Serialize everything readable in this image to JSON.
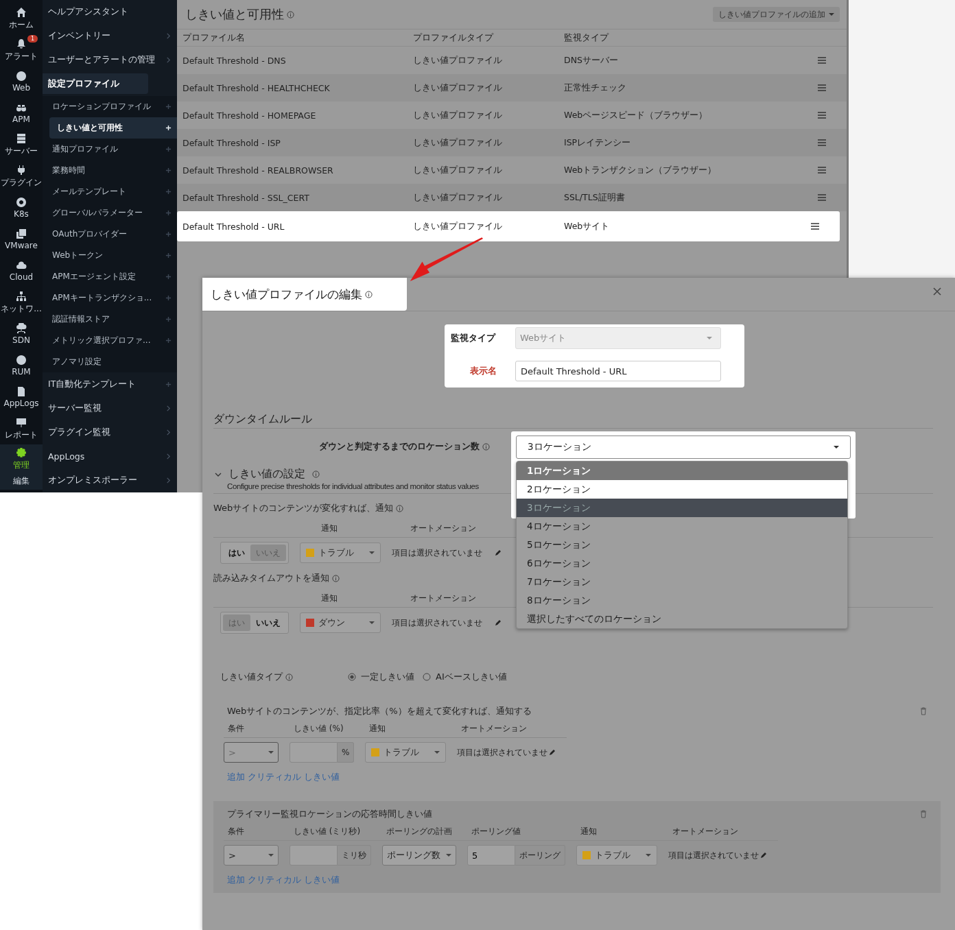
{
  "sidebar": {
    "rail": [
      {
        "label": "ホーム",
        "selected": false
      },
      {
        "label": "アラート",
        "badge": "1",
        "selected": false
      },
      {
        "label": "Web",
        "selected": false
      },
      {
        "label": "APM",
        "selected": false
      },
      {
        "label": "サーバー",
        "selected": false
      },
      {
        "label": "プラグイン",
        "selected": false
      },
      {
        "label": "K8s",
        "selected": false
      },
      {
        "label": "VMware",
        "selected": false
      },
      {
        "label": "Cloud",
        "selected": false
      },
      {
        "label": "ネットワ...",
        "selected": false
      },
      {
        "label": "SDN",
        "selected": false
      },
      {
        "label": "RUM",
        "selected": false
      },
      {
        "label": "AppLogs",
        "selected": false
      },
      {
        "label": "レポート",
        "selected": false
      },
      {
        "label": "管理",
        "sublabel": "編集",
        "selected": true
      }
    ],
    "menu": [
      {
        "label": "ヘルプアシスタント",
        "kind": "page"
      },
      {
        "label": "インベントリー",
        "kind": "group"
      },
      {
        "label": "ユーザーとアラートの管理",
        "kind": "group"
      },
      {
        "label": "設定プロファイル",
        "kind": "group",
        "expanded": true,
        "children": [
          {
            "label": "ロケーションプロファイル",
            "kind": "addable",
            "selected": false
          },
          {
            "label": "しきい値と可用性",
            "kind": "addable",
            "selected": true
          },
          {
            "label": "通知プロファイル",
            "kind": "addable",
            "selected": false
          },
          {
            "label": "業務時間",
            "kind": "addable",
            "selected": false
          },
          {
            "label": "メールテンプレート",
            "kind": "addable",
            "selected": false
          },
          {
            "label": "グローバルパラメーター",
            "kind": "addable",
            "selected": false
          },
          {
            "label": "OAuthプロバイダー",
            "kind": "addable",
            "selected": false
          },
          {
            "label": "Webトークン",
            "kind": "addable",
            "selected": false
          },
          {
            "label": "APMエージェント設定",
            "kind": "addable",
            "selected": false
          },
          {
            "label": "APMキートランザクショ...",
            "kind": "addable",
            "selected": false
          },
          {
            "label": "認証情報ストア",
            "kind": "addable",
            "selected": false
          },
          {
            "label": "メトリック選択プロファ...",
            "kind": "addable",
            "selected": false
          },
          {
            "label": "アノマリ設定",
            "kind": "page",
            "selected": false
          }
        ]
      },
      {
        "label": "IT自動化テンプレート",
        "kind": "addable"
      },
      {
        "label": "サーバー監視",
        "kind": "group"
      },
      {
        "label": "プラグイン監視",
        "kind": "group"
      },
      {
        "label": "AppLogs",
        "kind": "group"
      },
      {
        "label": "オンプレミスポーラー",
        "kind": "group"
      }
    ]
  },
  "list": {
    "title": "しきい値と可用性",
    "add_button": "しきい値プロファイルの追加",
    "columns": [
      "プロファイル名",
      "プロファイルタイプ",
      "監視タイプ"
    ],
    "rows": [
      {
        "name": "Default Threshold - DNS",
        "type": "しきい値プロファイル",
        "monitor": "DNSサーバー",
        "selected": false
      },
      {
        "name": "Default Threshold - HEALTHCHECK",
        "type": "しきい値プロファイル",
        "monitor": "正常性チェック",
        "selected": false
      },
      {
        "name": "Default Threshold - HOMEPAGE",
        "type": "しきい値プロファイル",
        "monitor": "Webページスピード（ブラウザー）",
        "selected": false
      },
      {
        "name": "Default Threshold - ISP",
        "type": "しきい値プロファイル",
        "monitor": "ISPレイテンシー",
        "selected": false
      },
      {
        "name": "Default Threshold - REALBROWSER",
        "type": "しきい値プロファイル",
        "monitor": "Webトランザクション（ブラウザー）",
        "selected": false
      },
      {
        "name": "Default Threshold - SSL_CERT",
        "type": "しきい値プロファイル",
        "monitor": "SSL/TLS証明書",
        "selected": false
      },
      {
        "name": "Default Threshold - URL",
        "type": "しきい値プロファイル",
        "monitor": "Webサイト",
        "selected": true
      }
    ]
  },
  "dialog": {
    "title": "しきい値プロファイルの編集",
    "monitor_type": {
      "label": "監視タイプ",
      "value": "Webサイト",
      "disabled": true
    },
    "display_name": {
      "label": "表示名",
      "value": "Default Threshold - URL",
      "required": true
    },
    "downtime": {
      "heading": "ダウンタイムルール",
      "label": "ダウンと判定するまでのロケーション数",
      "value": "3ロケーション",
      "open": true,
      "options": [
        {
          "label": "1ロケーション",
          "highlighted": true,
          "selected": false
        },
        {
          "label": "2ロケーション",
          "highlighted": false,
          "selected": false
        },
        {
          "label": "3ロケーション",
          "highlighted": false,
          "selected": true
        },
        {
          "label": "4ロケーション",
          "highlighted": false,
          "selected": false
        },
        {
          "label": "5ロケーション",
          "highlighted": false,
          "selected": false
        },
        {
          "label": "6ロケーション",
          "highlighted": false,
          "selected": false
        },
        {
          "label": "7ロケーション",
          "highlighted": false,
          "selected": false
        },
        {
          "label": "8ロケーション",
          "highlighted": false,
          "selected": false
        },
        {
          "label": "選択したすべてのロケーション",
          "highlighted": false,
          "selected": false
        }
      ]
    },
    "thresholds": {
      "heading": "しきい値の設定",
      "expanded": true,
      "description": "Configure precise thresholds for individual attributes and monitor status values",
      "rules": [
        {
          "title": "Webサイトのコンテンツが変化すれば、通知",
          "headers": [
            "通知",
            "オートメーション"
          ],
          "toggle": [
            {
              "label": "はい",
              "selected": true
            },
            {
              "label": "いいえ",
              "selected": false
            }
          ],
          "severity": {
            "label": "トラブル",
            "color": "#d4a017"
          },
          "automation": "項目は選択されていませ"
        },
        {
          "title": "読み込みタイムアウトを通知",
          "headers": [
            "通知",
            "オートメーション"
          ],
          "toggle": [
            {
              "label": "はい",
              "selected": false
            },
            {
              "label": "いいえ",
              "selected": true
            }
          ],
          "severity": {
            "label": "ダウン",
            "color": "#c0392b"
          },
          "automation": "項目は選択されていませ"
        }
      ],
      "type_label": "しきい値タイプ",
      "types": [
        {
          "label": "一定しきい値",
          "selected": true
        },
        {
          "label": "AIベースしきい値",
          "selected": false
        }
      ],
      "blocks": [
        {
          "title": "Webサイトのコンテンツが、指定比率（%）を超えて変化すれば、通知する",
          "shaded": false,
          "columns": [
            {
              "header": "条件",
              "kind": "select",
              "value": ">",
              "dim": true
            },
            {
              "header": "しきい値 (%)",
              "kind": "addon",
              "addon": "%"
            },
            {
              "header": "通知",
              "kind": "severity",
              "value": "トラブル",
              "color": "#d4a017"
            },
            {
              "header": "オートメーション",
              "kind": "text",
              "value": "項目は選択されていませ"
            }
          ],
          "link": "追加 クリティカル しきい値"
        },
        {
          "title": "プライマリー監視ロケーションの応答時間しきい値",
          "shaded": true,
          "columns": [
            {
              "header": "条件",
              "kind": "select",
              "value": ">",
              "dim": false
            },
            {
              "header": "しきい値 (ミリ秒)",
              "kind": "addon",
              "addon": "ミリ秒"
            },
            {
              "header": "ポーリングの計画",
              "kind": "select",
              "value": "ポーリング数",
              "dim": false
            },
            {
              "header": "ポーリング値",
              "kind": "addon",
              "value": "5",
              "addon": "ポーリング"
            },
            {
              "header": "通知",
              "kind": "severity",
              "value": "トラブル",
              "color": "#d4a017"
            },
            {
              "header": "オートメーション",
              "kind": "text",
              "value": "項目は選択されていませ"
            }
          ],
          "link": "追加 クリティカル しきい値"
        }
      ]
    }
  }
}
